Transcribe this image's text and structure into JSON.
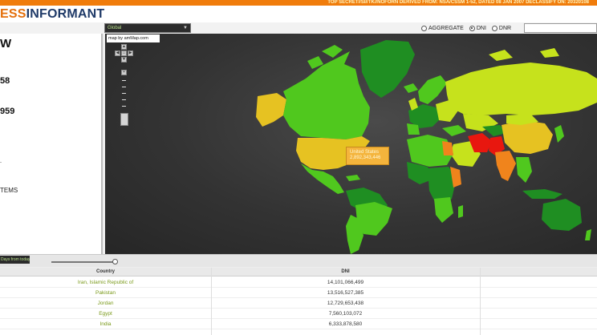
{
  "banner": {
    "text": "TOP SECRET//SI//TK//NOFORN DERIVED FROM: NSA/CSSM 1-52, DATED 08 JAN 2007 DECLASSIFY ON: 20320108"
  },
  "header": {
    "logo_part1": "ESS",
    "logo_part2": "INFORMANT"
  },
  "toolbar": {
    "dropdown_value": "Global",
    "radios": [
      {
        "label": "AGGREGATE",
        "selected": false
      },
      {
        "label": "DNI",
        "selected": true
      },
      {
        "label": "DNR",
        "selected": false
      }
    ],
    "search_value": ""
  },
  "left_panel": {
    "title": "W",
    "stat1": "58",
    "stat2": "959",
    "marker": "-",
    "items_label": "TEMS"
  },
  "map": {
    "credit": "map by amMap.com",
    "tooltip": {
      "country": "United States",
      "value": "2,892,343,446"
    },
    "colors": {
      "red": "#e8170f",
      "orange": "#f0841c",
      "yellow": "#e6c222",
      "yellowgreen": "#c6e21c",
      "green": "#50c81e",
      "darkgreen": "#1f8e22",
      "tooltip": "#f4b43c"
    }
  },
  "controls": {
    "period_button": "Days from today"
  },
  "table": {
    "columns": [
      "Country",
      "DNI"
    ],
    "rows": [
      {
        "country": "Iran, Islamic Republic of",
        "dni": "14,101,066,499"
      },
      {
        "country": "Pakistan",
        "dni": "13,516,527,385"
      },
      {
        "country": "Jordan",
        "dni": "12,729,653,438"
      },
      {
        "country": "Egypt",
        "dni": "7,560,103,072"
      },
      {
        "country": "India",
        "dni": "6,333,878,580"
      }
    ]
  }
}
